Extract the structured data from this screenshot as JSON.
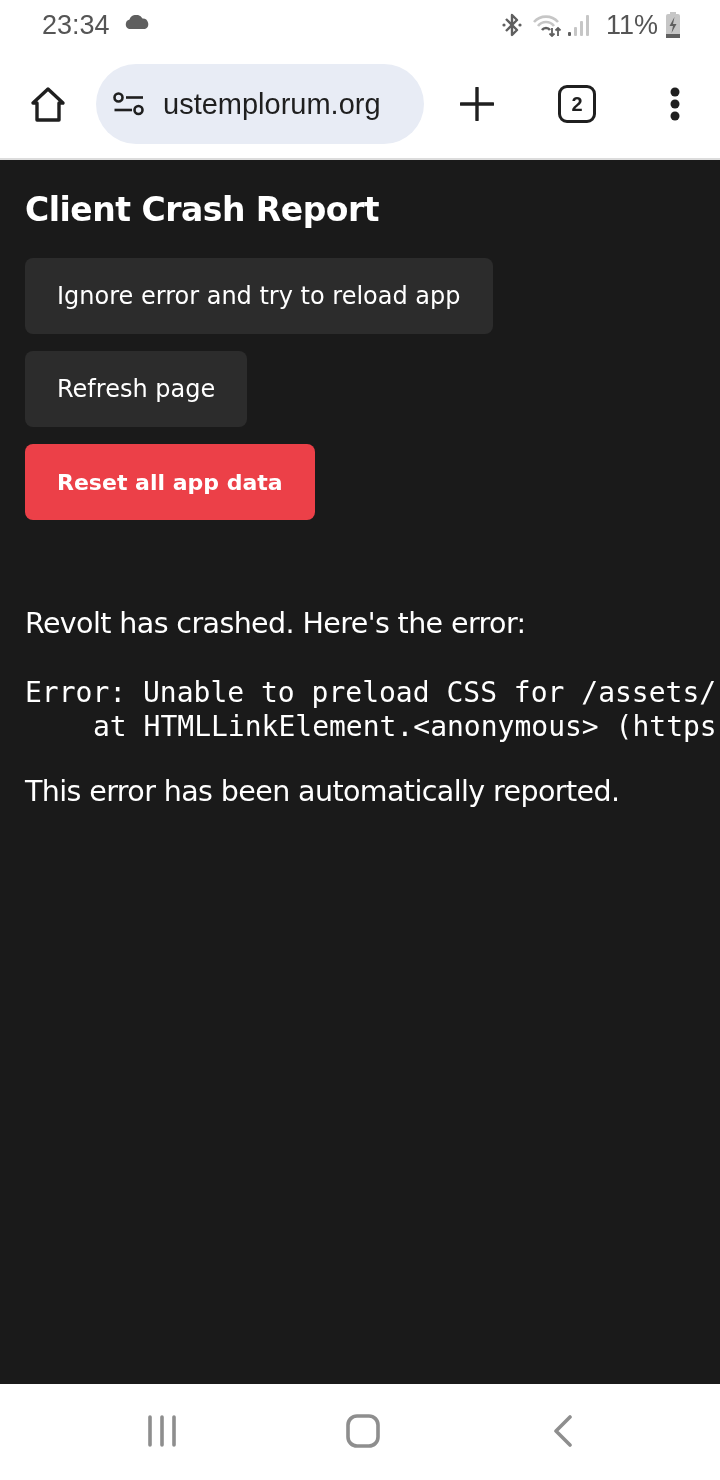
{
  "status_bar": {
    "time": "23:34",
    "battery": "11%"
  },
  "browser": {
    "url": "ustemplorum.org",
    "tab_count": "2"
  },
  "page": {
    "title": "Client Crash Report",
    "buttons": [
      {
        "label": "Ignore error and try to reload app",
        "kind": "secondary"
      },
      {
        "label": "Refresh page",
        "kind": "secondary"
      },
      {
        "label": "Reset all app data",
        "kind": "danger"
      }
    ],
    "message": "Revolt has crashed. Here's the error:",
    "error": {
      "message": "Error: Unable to preload CSS for /assets/",
      "stack": [
        "at HTMLLinkElement.<anonymous> (https"
      ]
    },
    "footer": "This error has been automatically reported."
  }
}
